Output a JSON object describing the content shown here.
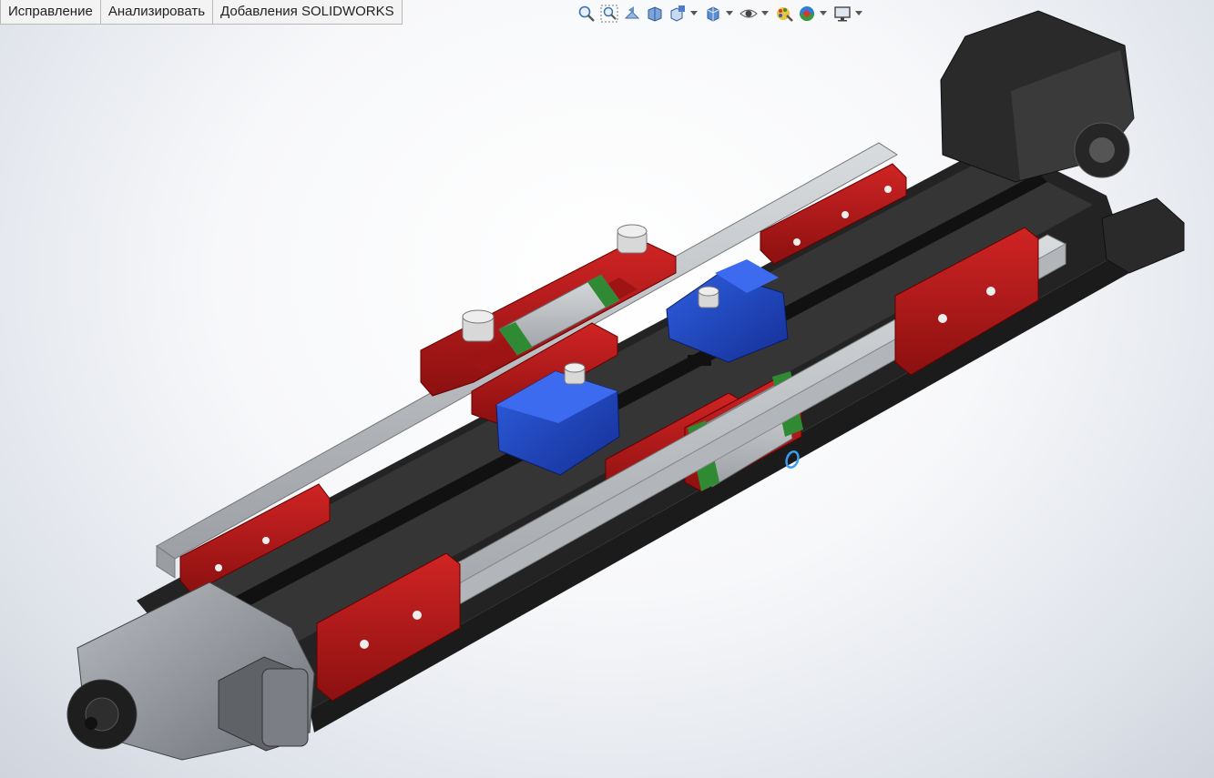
{
  "command_manager": {
    "tabs": [
      {
        "label": "Исправление"
      },
      {
        "label": "Анализировать"
      },
      {
        "label": "Добавления SOLIDWORKS"
      }
    ]
  },
  "headsup_toolbar": {
    "icons": [
      "zoom-to-fit-icon",
      "zoom-to-area-icon",
      "previous-view-icon",
      "section-view-icon",
      "view-orientation-icon",
      "display-style-icon",
      "hide-show-items-icon",
      "edit-appearance-icon",
      "apply-scene-icon",
      "view-settings-icon"
    ]
  },
  "model": {
    "colors": {
      "frame": "#2b2b2b",
      "carriage_block": "#b01818",
      "clamp": "#1b3fb8",
      "rail": "#b9bdc1",
      "seal": "#2f8a33",
      "motor_housing": "#8c8f94",
      "cursor_marker": "#3a9df0"
    }
  }
}
